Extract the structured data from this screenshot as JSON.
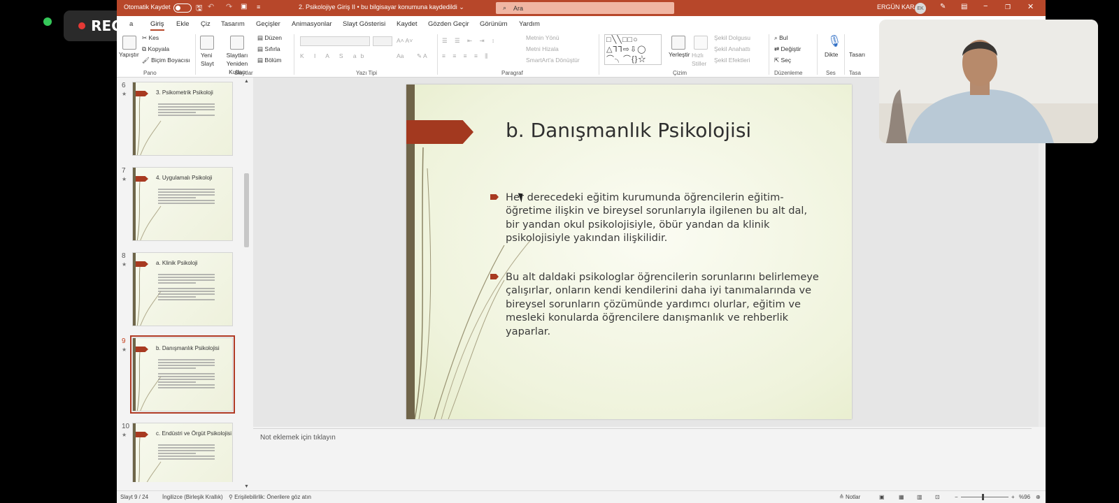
{
  "recording": {
    "label": "REC"
  },
  "titlebar": {
    "autosave_label": "Otomatik Kaydet",
    "document_title": "2. Psikolojiye Giriş II  •  bu bilgisayar konumuna kaydedildi ⌄",
    "search_placeholder": "Ara",
    "user_name": "ERGÜN KARA",
    "user_initials": "EK"
  },
  "menu": [
    "Dosya",
    "Giriş",
    "Ekle",
    "Çiz",
    "Tasarım",
    "Geçişler",
    "Animasyonlar",
    "Slayt Gösterisi",
    "Kaydet",
    "Gözden Geçir",
    "Görünüm",
    "Yardım"
  ],
  "menu_visible": {
    "file_fragment": "a",
    "home": "Giriş",
    "insert": "Ekle",
    "draw": "Çiz",
    "design": "Tasarım",
    "transitions": "Geçişler",
    "animations": "Animasyonlar",
    "slideshow": "Slayt Gösterisi",
    "record": "Kaydet",
    "review": "Gözden Geçir",
    "view": "Görünüm",
    "help": "Yardım"
  },
  "ribbon": {
    "paste": "Yapıştır",
    "cut": "Kes",
    "copy": "Kopyala",
    "format_painter": "Biçim Boyacısı",
    "group_clipboard": "Pano",
    "new_slide": "Yeni Slayt",
    "reuse_slides": "Slaytları Yeniden Kullan",
    "layout": "Düzen",
    "reset": "Sıfırla",
    "section": "Bölüm",
    "group_slides": "Slaytlar",
    "group_font": "Yazı Tipi",
    "text_direction": "Metnin Yönü",
    "align_text": "Metni Hizala",
    "convert_smartart": "SmartArt'a Dönüştür",
    "group_paragraph": "Paragraf",
    "arrange": "Yerleştir",
    "quick_styles": "Hızlı Stiller",
    "shape_fill": "Şekil Dolgusu",
    "shape_outline": "Şekil Anahattı",
    "shape_effects": "Şekil Efektleri",
    "group_drawing": "Çizim",
    "find": "Bul",
    "replace": "Değiştir",
    "select": "Seç",
    "group_editing": "Düzenleme",
    "dictate": "Dikte",
    "group_voice": "Ses",
    "designer_fragment": "Tasarı",
    "group_designer_fragment": "Tasa"
  },
  "thumbnails": [
    {
      "num": "6",
      "title": "3. Psikometrik Psikoloji",
      "lines": 5
    },
    {
      "num": "7",
      "title": "4. Uygulamalı Psikoloji",
      "lines": 6
    },
    {
      "num": "8",
      "title": "a. Klinik Psikoloji",
      "lines": 9
    },
    {
      "num": "9",
      "title": "b. Danışmanlık Psikolojisi",
      "lines": 10,
      "selected": true
    },
    {
      "num": "10",
      "title": "c. Endüstri ve Örgüt Psikolojisi",
      "lines": 6
    }
  ],
  "slide": {
    "title": "b. Danışmanlık Psikolojisi",
    "bullets": [
      "Her derecedeki eğitim kurumunda öğrencilerin eğitim-öğretime ilişkin ve bireysel sorunlarıyla ilgilenen bu alt dal, bir yandan okul psikolojisiyle, öbür yandan da klinik psikolojisiyle yakından ilişkilidir.",
      "Bu alt daldaki psikologlar öğrencilerin sorunlarını belirlemeye çalışırlar, onların kendi kendilerini daha iyi tanımalarında ve bireysel sorunların çözümünde yardımcı olurlar, eğitim ve mesleki konularda öğrencilere danışmanlık ve rehberlik yaparlar."
    ]
  },
  "notes": {
    "placeholder": "Not eklemek için tıklayın"
  },
  "status": {
    "slide_counter": "Slayt 9 / 24",
    "language": "İngilizce (Birleşik Krallık)",
    "accessibility": "Erişilebilirlik: Önerilere göz atın",
    "notes_button": "Notlar",
    "zoom": "%96"
  },
  "colors": {
    "accent": "#b7472a",
    "slide_red": "#a3391f",
    "slide_bar": "#6f6449"
  }
}
